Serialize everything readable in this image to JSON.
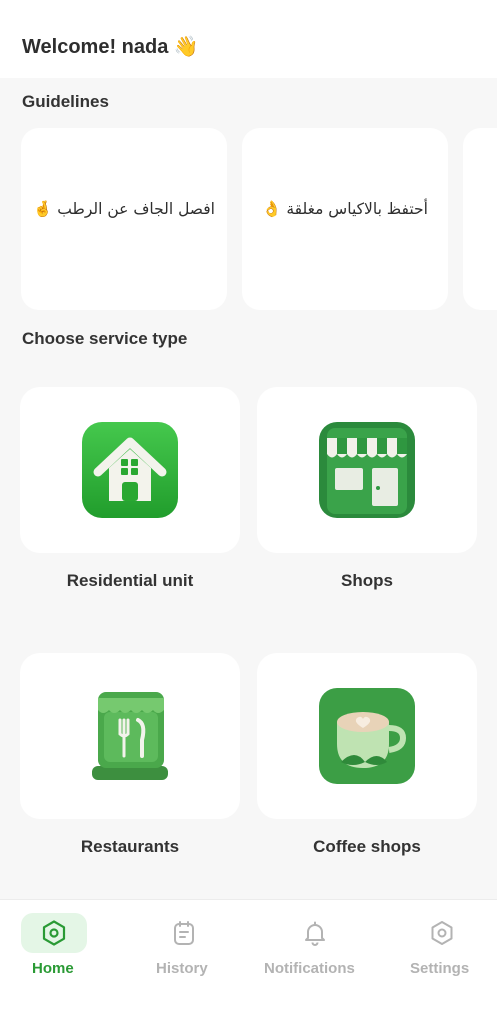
{
  "header": {
    "welcome": "Welcome! nada",
    "wave_emoji": "👋"
  },
  "guidelines": {
    "title": "Guidelines",
    "cards": [
      {
        "text": "افصل الجاف عن الرطب",
        "emoji": "🤞"
      },
      {
        "text": "أحتفظ بالاكياس مغلقة",
        "emoji": "👌"
      },
      {
        "text": "",
        "emoji": ""
      }
    ]
  },
  "services": {
    "title": "Choose service type",
    "items": [
      {
        "label": "Residential unit",
        "icon": "house-icon"
      },
      {
        "label": "Shops",
        "icon": "shop-icon"
      },
      {
        "label": "Restaurants",
        "icon": "restaurant-icon"
      },
      {
        "label": "Coffee shops",
        "icon": "coffee-cup-icon"
      }
    ]
  },
  "nav": {
    "items": [
      {
        "label": "Home",
        "icon": "home-icon",
        "active": true
      },
      {
        "label": "History",
        "icon": "history-icon",
        "active": false
      },
      {
        "label": "Notifications",
        "icon": "bell-icon",
        "active": false
      },
      {
        "label": "Settings",
        "icon": "settings-icon",
        "active": false
      }
    ]
  },
  "colors": {
    "accent": "#2a9a35",
    "active_tab_bg": "#e4f6e6",
    "inactive": "#b3b3b3",
    "page_bg": "#f7f7f7",
    "card_bg": "#ffffff"
  }
}
